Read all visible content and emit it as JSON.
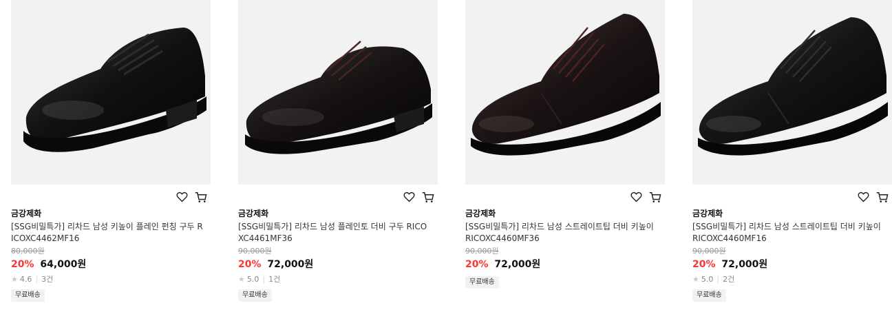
{
  "icons": {
    "wishlist": "heart-outline-icon",
    "cart": "cart-icon",
    "star": "star-icon"
  },
  "colors": {
    "discount": "#ff3333",
    "image_bg": "#f2f2f2",
    "badge_bg": "#f2f2f2"
  },
  "products": [
    {
      "brand": "금강제화",
      "title": "[SSG비밀특가] 리차드 남성 키높이 플레인 펀칭 구두 RICOXC4462MF16",
      "original_price": "80,000원",
      "discount": "20%",
      "price": "64,000원",
      "rating": "4.6",
      "reviews": "3건",
      "badge": "무료배송",
      "has_rating": true
    },
    {
      "brand": "금강제화",
      "title": "[SSG비밀특가] 리차드 남성 플레인토 더비 구두 RICOXC4461MF36",
      "original_price": "90,000원",
      "discount": "20%",
      "price": "72,000원",
      "rating": "5.0",
      "reviews": "1건",
      "badge": "무료배송",
      "has_rating": true
    },
    {
      "brand": "금강제화",
      "title": "[SSG비밀특가] 리차드 남성 스트레이트팁 더비 키높이 RICOXC4460MF36",
      "original_price": "90,000원",
      "discount": "20%",
      "price": "72,000원",
      "rating": "",
      "reviews": "",
      "badge": "무료배송",
      "has_rating": false
    },
    {
      "brand": "금강제화",
      "title": "[SSG비밀특가] 리차드 남성 스트레이트팁 더비 키높이 RICOXC4460MF16",
      "original_price": "90,000원",
      "discount": "20%",
      "price": "72,000원",
      "rating": "5.0",
      "reviews": "2건",
      "badge": "무료배송",
      "has_rating": true
    }
  ]
}
